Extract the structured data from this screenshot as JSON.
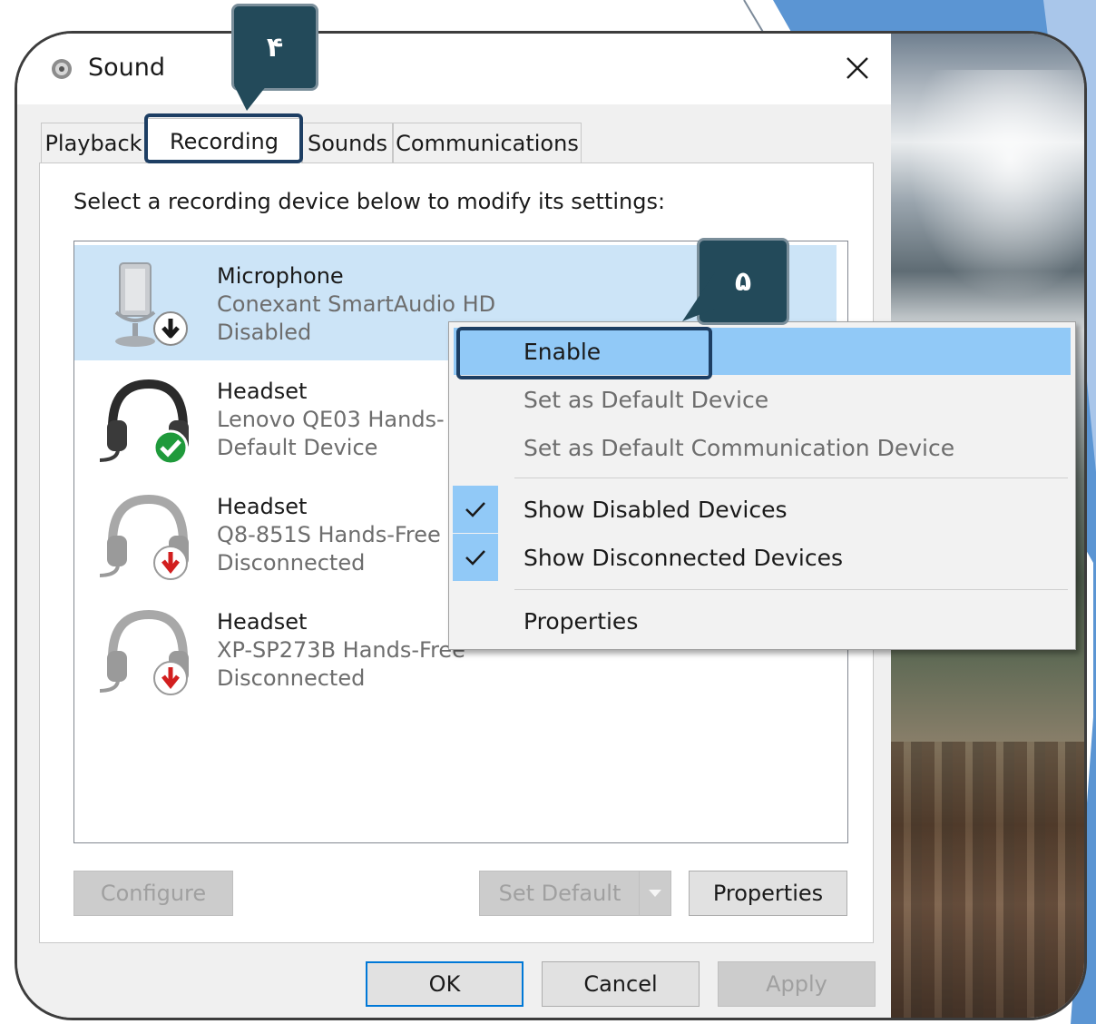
{
  "window": {
    "title": "Sound"
  },
  "tabs": [
    {
      "label": "Playback"
    },
    {
      "label": "Recording"
    },
    {
      "label": "Sounds"
    },
    {
      "label": "Communications"
    }
  ],
  "instructions": "Select a recording device below to modify its settings:",
  "devices": [
    {
      "name": "Microphone",
      "driver": "Conexant SmartAudio HD",
      "status": "Disabled"
    },
    {
      "name": "Headset",
      "driver": "Lenovo QE03 Hands-",
      "status": "Default Device"
    },
    {
      "name": "Headset",
      "driver": "Q8-851S Hands-Free",
      "status": "Disconnected"
    },
    {
      "name": "Headset",
      "driver": "XP-SP273B Hands-Free",
      "status": "Disconnected"
    }
  ],
  "buttons": {
    "configure": "Configure",
    "set_default": "Set Default",
    "properties": "Properties",
    "ok": "OK",
    "cancel": "Cancel",
    "apply": "Apply"
  },
  "context_menu": [
    {
      "label": "Enable"
    },
    {
      "label": "Set as Default Device"
    },
    {
      "label": "Set as Default Communication Device"
    },
    {
      "label": "Show Disabled Devices"
    },
    {
      "label": "Show Disconnected Devices"
    },
    {
      "label": "Properties"
    }
  ],
  "callouts": {
    "step4": "۴",
    "step5": "۵"
  },
  "colors": {
    "selection": "#cce4f7",
    "menu_hover": "#91c9f7",
    "highlight_border": "#1d3e63",
    "callout_bg": "#234a5a",
    "accent_blue": "#0078d7",
    "slide_blue": "#5b95d3"
  },
  "icons": {
    "title": "speaker-icon",
    "close": "close-icon",
    "disabled_badge": "down-arrow-icon",
    "default_badge": "check-icon",
    "disconnected_badge": "red-down-arrow-icon"
  }
}
